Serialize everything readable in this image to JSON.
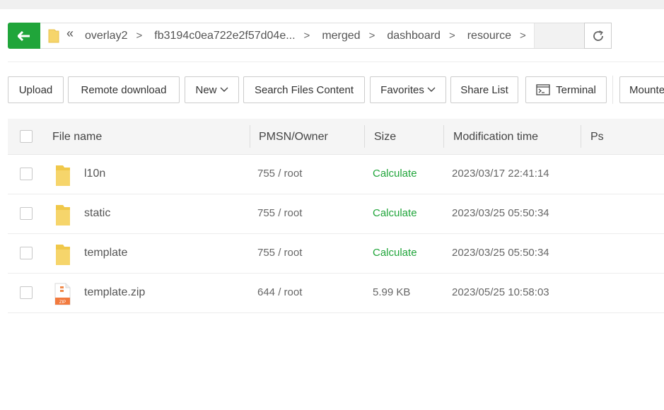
{
  "path": {
    "crumbs": [
      "overlay2",
      "fb3194c0ea722e2f57d04e...",
      "merged",
      "dashboard",
      "resource"
    ]
  },
  "toolbar": {
    "upload": "Upload",
    "remote_download": "Remote download",
    "new": "New",
    "search_files_content": "Search Files Content",
    "favorites": "Favorites",
    "share_list": "Share List",
    "terminal": "Terminal",
    "mount": "Mounte"
  },
  "table": {
    "headers": {
      "name": "File name",
      "perm": "PMSN/Owner",
      "size": "Size",
      "mtime": "Modification time",
      "ps": "Ps"
    },
    "rows": [
      {
        "name": "l10n",
        "perm": "755 / root",
        "size": "Calculate",
        "mtime": "2023/03/17 22:41:14",
        "type": "folder"
      },
      {
        "name": "static",
        "perm": "755 / root",
        "size": "Calculate",
        "mtime": "2023/03/25 05:50:34",
        "type": "folder"
      },
      {
        "name": "template",
        "perm": "755 / root",
        "size": "Calculate",
        "mtime": "2023/03/25 05:50:34",
        "type": "folder"
      },
      {
        "name": "template.zip",
        "perm": "644 / root",
        "size": "5.99 KB",
        "mtime": "2023/05/25 10:58:03",
        "type": "zip"
      }
    ]
  },
  "colors": {
    "accent": "#20a53a",
    "folder": "#f6d56b"
  }
}
